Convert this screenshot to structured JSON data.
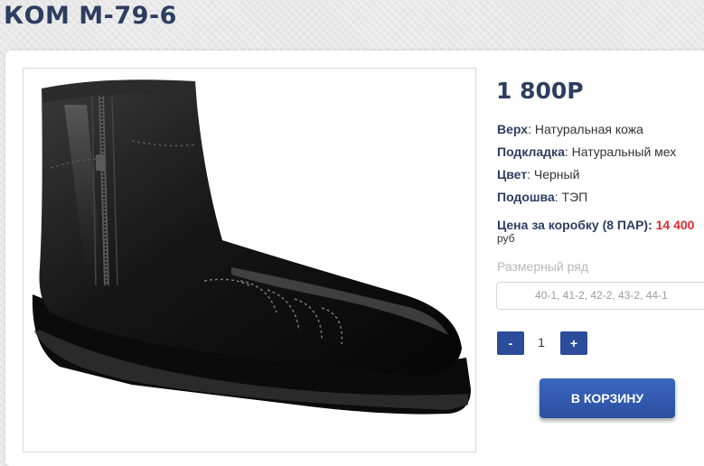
{
  "product": {
    "title": "КОМ М-79-6",
    "price": "1 800Р",
    "image_icon": "black-leather-ankle-boot-photo"
  },
  "specs": [
    {
      "label": "Верх",
      "value": ": Натуральная кожа"
    },
    {
      "label": "Подкладка",
      "value": ": Натуральный мех"
    },
    {
      "label": "Цвет",
      "value": ": Черный"
    },
    {
      "label": "Подошва",
      "value": ": ТЭП"
    }
  ],
  "box_price": {
    "label": "Цена за коробку (8 ПАР): ",
    "amount": "14 400",
    "currency": "руб"
  },
  "sizes": {
    "label": "Размерный ряд",
    "value": "40-1, 41-2, 42-2, 43-2, 44-1"
  },
  "quantity": {
    "minus": "-",
    "value": "1",
    "plus": "+"
  },
  "cart": {
    "label": "В КОРЗИНУ"
  },
  "colors": {
    "title": "#2c3e60",
    "accent_red": "#e32b2b",
    "button_blue": "#2b4c9a"
  }
}
